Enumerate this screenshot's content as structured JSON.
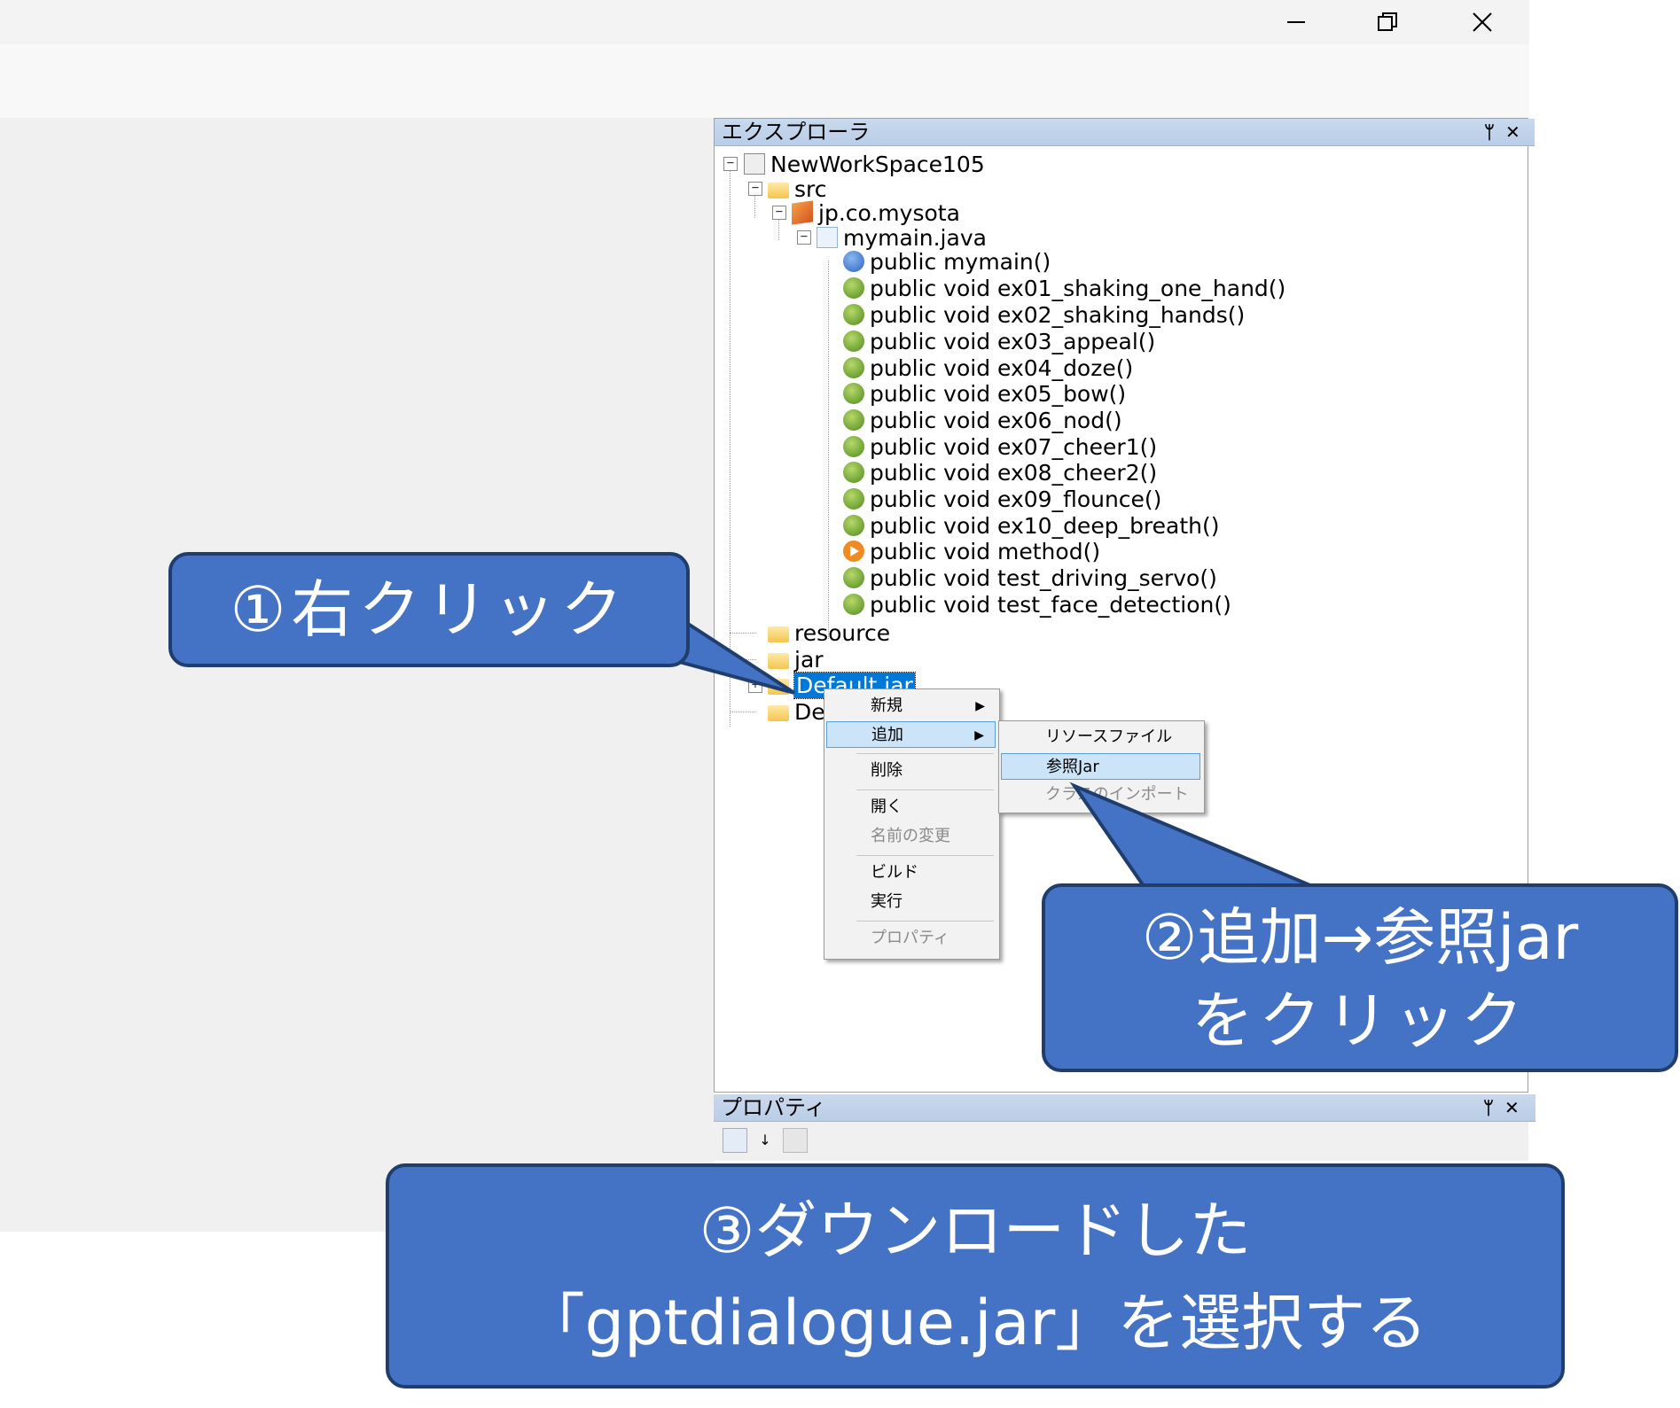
{
  "explorer": {
    "title": "エクスプローラ",
    "pin": "ᛘ",
    "close": "✕",
    "tree": {
      "workspace": "NewWorkSpace105",
      "src": "src",
      "package": "jp.co.mysota",
      "file": "mymain.java",
      "constructor": "public mymain()",
      "methods": [
        "public void ex01_shaking_one_hand()",
        "public void ex02_shaking_hands()",
        "public void ex03_appeal()",
        "public void ex04_doze()",
        "public void ex05_bow()",
        "public void ex06_nod()",
        "public void ex07_cheer1()",
        "public void ex08_cheer2()",
        "public void ex09_flounce()",
        "public void ex10_deep_breath()"
      ],
      "method_play": "public void method()",
      "methods_tail": [
        "public void test_driving_servo()",
        "public void test_face_detection()"
      ],
      "resource": "resource",
      "jar": "jar",
      "default_jar": "Default.jar",
      "default_other": "De"
    }
  },
  "context_menu": {
    "items": [
      "新規",
      "追加",
      "削除",
      "開く",
      "名前の変更",
      "ビルド",
      "実行",
      "プロパティ"
    ],
    "submenu": [
      "リソースファイル",
      "参照Jar",
      "クラスのインポート"
    ]
  },
  "properties": {
    "title": "プロパティ",
    "pin": "ᛘ",
    "close": "✕"
  },
  "callouts": {
    "step1": "①右クリック",
    "step2_line1": "②追加→参照jar",
    "step2_line2": "をクリック",
    "step3_line1": "③ダウンロードした",
    "step3_line2": "「gptdialogue.jar」を選択する"
  },
  "colors": {
    "callout_fill": "#4472c4",
    "callout_border": "#1f3e6e",
    "selection": "#0078d7",
    "menu_highlight": "#cce4f7"
  }
}
